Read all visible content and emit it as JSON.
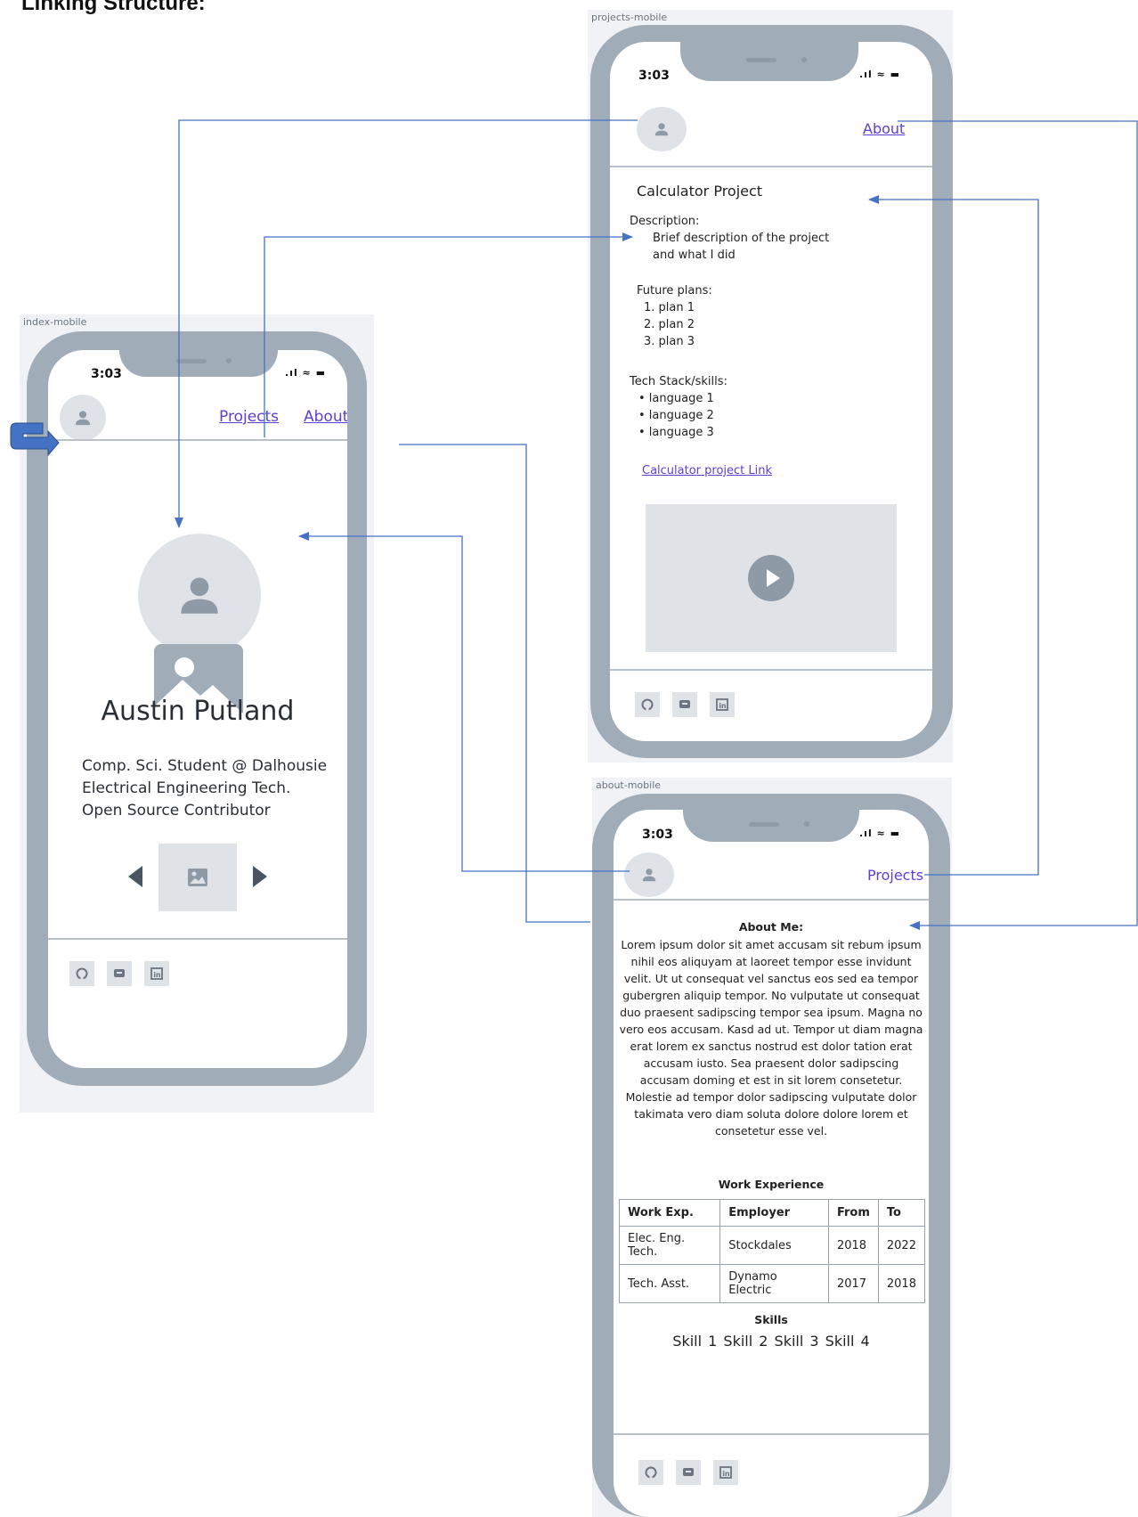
{
  "heading": "Linking Structure:",
  "index": {
    "frame_label": "index-mobile",
    "time": "3:03",
    "signal": ".ıl ≈ ▬",
    "nav": {
      "projects": "Projects",
      "about": "About"
    },
    "name": "Austin Putland",
    "bio": [
      "Comp. Sci. Student @ Dalhousie",
      "Electrical Engineering Tech.",
      "Open Source Contributor"
    ]
  },
  "projects": {
    "frame_label": "projects-mobile",
    "time": "3:03",
    "signal": ".ıl ≈ ▬",
    "nav": {
      "about": "About"
    },
    "title": "Calculator Project",
    "description_label": "Description:",
    "description_lines": [
      "Brief description of the project",
      "and what I did"
    ],
    "future_label": "Future plans:",
    "plans": [
      "1.  plan 1",
      "2.  plan 2",
      "3.  plan 3"
    ],
    "stack_label": "Tech Stack/skills:",
    "languages": [
      "•  language 1",
      "•  language 2",
      "•  language 3"
    ],
    "project_link": "Calculator project Link"
  },
  "about": {
    "frame_label": "about-mobile",
    "time": "3:03",
    "signal": ".ıl ≈ ▬",
    "nav": {
      "projects": "Projects"
    },
    "about_title": "About Me:",
    "about_lines": [
      "Lorem ipsum dolor sit amet accusam sit rebum ipsum",
      "nihil eos aliquyam at laoreet tempor esse invidunt",
      "velit. Ut ut consequat vel sanctus eos sed ea tempor",
      "gubergren aliquip tempor. No vulputate ut consequat",
      "duo praesent sadipscing tempor sea ipsum. Magna no",
      "vero eos accusam. Kasd ad ut. Tempor ut diam magna",
      "erat lorem ex sanctus nostrud est dolor tation erat",
      "accusam iusto. Sea praesent dolor sadipscing",
      "accusam doming et est in sit lorem consetetur.",
      "Molestie ad tempor dolor sadipscing vulputate dolor",
      "takimata vero diam soluta dolore dolore lorem et",
      "consetetur esse vel."
    ],
    "work_title": "Work Experience",
    "work_headers": [
      "Work Exp.",
      "Employer",
      "From",
      "To"
    ],
    "work_rows": [
      [
        "Elec. Eng. Tech.",
        "Stockdales",
        "2018",
        "2022"
      ],
      [
        "Tech. Asst.",
        "Dynamo Electric",
        "2017",
        "2018"
      ]
    ],
    "skills_title": "Skills",
    "skills": [
      "Skill 1",
      "Skill 2",
      "Skill 3",
      "Skill 4"
    ]
  },
  "colors": {
    "link": "#5b3fd6",
    "arrow": "#4472c4",
    "phone": "#a0adb9",
    "placeholder": "#dfe3e8"
  }
}
